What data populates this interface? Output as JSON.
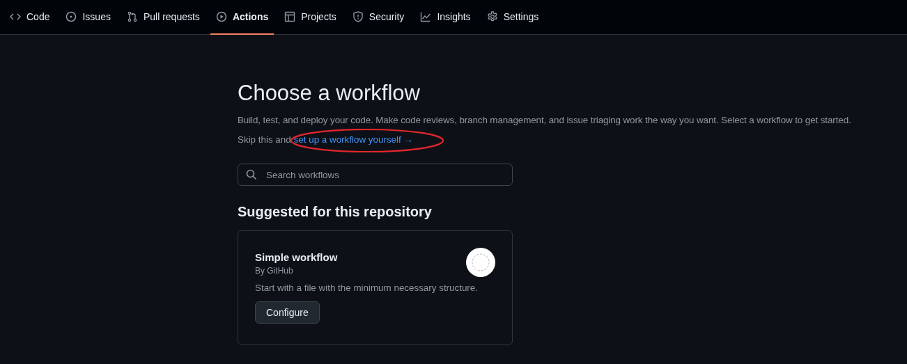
{
  "tabs": [
    {
      "label": "Code",
      "kind": "code",
      "selected": false
    },
    {
      "label": "Issues",
      "kind": "issues",
      "selected": false
    },
    {
      "label": "Pull requests",
      "kind": "pulls",
      "selected": false
    },
    {
      "label": "Actions",
      "kind": "actions",
      "selected": true
    },
    {
      "label": "Projects",
      "kind": "projects",
      "selected": false
    },
    {
      "label": "Security",
      "kind": "security",
      "selected": false
    },
    {
      "label": "Insights",
      "kind": "insights",
      "selected": false
    },
    {
      "label": "Settings",
      "kind": "settings",
      "selected": false
    }
  ],
  "title": "Choose a workflow",
  "description": "Build, test, and deploy your code. Make code reviews, branch management, and issue triaging work the way you want. Select a workflow to get started.",
  "skip": {
    "prefix": "Skip this and",
    "link": "set up a workflow yourself →",
    "highlighted": true
  },
  "search": {
    "placeholder": "Search workflows"
  },
  "section_title": "Suggested for this repository",
  "workflows": [
    {
      "name": "Simple workflow",
      "author": "By GitHub",
      "description": "Start with a file with the minimum necessary structure.",
      "button": "Configure"
    }
  ]
}
